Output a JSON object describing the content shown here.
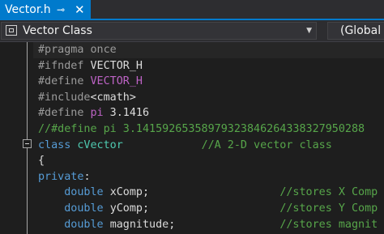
{
  "tab": {
    "title": "Vector.h",
    "pin_glyph": "⊸",
    "close_glyph": "✕"
  },
  "navbar": {
    "class_dropdown": "Vector Class",
    "scope_dropdown": "(Global S"
  },
  "code_lines": [
    [
      {
        "t": "#pragma once",
        "c": "k-pre"
      }
    ],
    [
      {
        "t": "#ifndef ",
        "c": "k-pre"
      },
      {
        "t": "VECTOR_H",
        "c": "k-plain"
      }
    ],
    [
      {
        "t": "#define ",
        "c": "k-pre"
      },
      {
        "t": "VECTOR_H",
        "c": "k-macro"
      }
    ],
    [
      {
        "t": "#include",
        "c": "k-pre"
      },
      {
        "t": "<cmath>",
        "c": "k-plain"
      }
    ],
    [
      {
        "t": "#define ",
        "c": "k-pre"
      },
      {
        "t": "pi",
        "c": "k-macro"
      },
      {
        "t": " 3.1416",
        "c": "k-plain"
      }
    ],
    [
      {
        "t": "//#define pi 3.14159265358979323846264338327950288",
        "c": "k-cmt"
      }
    ],
    [
      {
        "t": "class ",
        "c": "k-kw"
      },
      {
        "t": "cVector",
        "c": "k-type"
      },
      {
        "t": "            ",
        "c": "k-plain"
      },
      {
        "t": "//A 2-D vector class",
        "c": "k-cmt"
      }
    ],
    [
      {
        "t": "{",
        "c": "k-plain"
      }
    ],
    [
      {
        "t": "private",
        "c": "k-kw"
      },
      {
        "t": ":",
        "c": "k-plain"
      }
    ],
    [
      {
        "t": "    ",
        "c": "k-plain"
      },
      {
        "t": "double",
        "c": "k-kw"
      },
      {
        "t": " ",
        "c": "k-plain"
      },
      {
        "t": "xComp",
        "c": "k-var"
      },
      {
        "t": ";                    ",
        "c": "k-plain"
      },
      {
        "t": "//stores X Comp",
        "c": "k-cmt"
      }
    ],
    [
      {
        "t": "    ",
        "c": "k-plain"
      },
      {
        "t": "double",
        "c": "k-kw"
      },
      {
        "t": " ",
        "c": "k-plain"
      },
      {
        "t": "yComp",
        "c": "k-var"
      },
      {
        "t": ";                    ",
        "c": "k-plain"
      },
      {
        "t": "//stores Y Comp",
        "c": "k-cmt"
      }
    ],
    [
      {
        "t": "    ",
        "c": "k-plain"
      },
      {
        "t": "double",
        "c": "k-kw"
      },
      {
        "t": " ",
        "c": "k-plain"
      },
      {
        "t": "magnitude",
        "c": "k-var"
      },
      {
        "t": ";                ",
        "c": "k-plain"
      },
      {
        "t": "//stores magnit",
        "c": "k-cmt"
      }
    ]
  ]
}
